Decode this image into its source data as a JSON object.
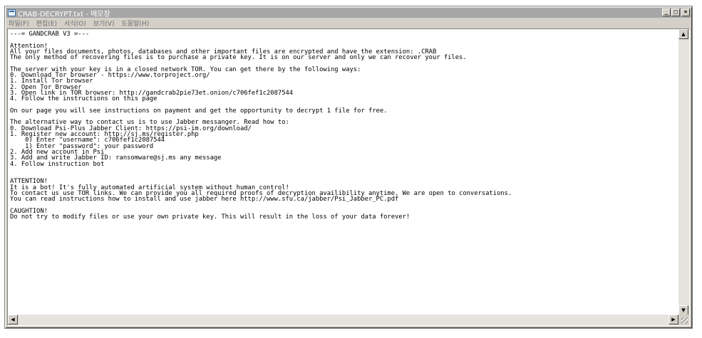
{
  "window": {
    "title": "CRAB-DECRYPT.txt - 메모장",
    "icon": "notepad-icon",
    "minimize_label": "_",
    "maximize_label": "□",
    "close_label": "×"
  },
  "menu": {
    "items": [
      "파일(F)",
      "편집(E)",
      "서식(O)",
      "보기(V)",
      "도움말(H)"
    ]
  },
  "scrollbars": {
    "up_arrow": "▲",
    "down_arrow": "▼",
    "left_arrow": "◀",
    "right_arrow": "▶"
  },
  "document": {
    "lines": [
      "---= GANDCRAB V3 =---",
      "",
      "Attention!",
      "All your files documents, photos, databases and other important files are encrypted and have the extension: .CRAB",
      "The only method of recovering files is to purchase a private key. It is on our server and only we can recover your files.",
      "",
      "The server with your key is in a closed network TOR. You can get there by the following ways:",
      "0. Download Tor browser - https://www.torproject.org/",
      "1. Install Tor browser",
      "2. Open Tor Browser",
      "3. Open link in TOR browser: http://gandcrab2pie73et.onion/c706fef1c2087544",
      "4. Follow the instructions on this page",
      "",
      "On our page you will see instructions on payment and get the opportunity to decrypt 1 file for free.",
      "",
      "The alternative way to contact us is to use Jabber messanger. Read how to:",
      "0. Download Psi-Plus Jabber Client: https://psi-im.org/download/",
      "1. Register new account: http://sj.ms/register.php",
      "    0) Enter \"username\": c706fef1c2087544",
      "    1) Enter \"password\": your password",
      "2. Add new account in Psi",
      "3. Add and write Jabber ID: ransomware@sj.ms any message",
      "4. Follow instruction bot",
      "",
      "",
      "ATTENTION!",
      "It is a bot! It's fully automated artificial system without human control!",
      "To contact us use TOR links. We can provide you all required proofs of decryption availibility anytime. We are open to conversations.",
      "You can read instructions how to install and use jabber here http://www.sfu.ca/jabber/Psi_Jabber_PC.pdf",
      "",
      "CAUGHTION!",
      "Do not try to modify files or use your own private key. This will result in the loss of your data forever!"
    ]
  }
}
